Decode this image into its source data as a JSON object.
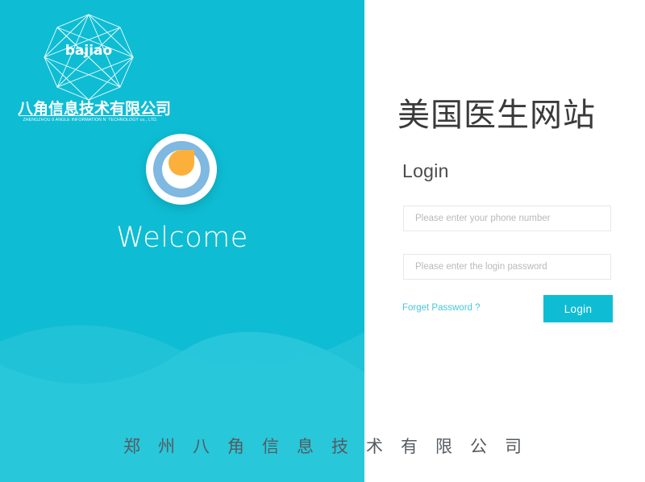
{
  "brand": {
    "logo_mark_text": "bajiao",
    "company_name_cn": "八角信息技术有限公司",
    "company_name_en": "ZHENGZHOU 8 ANGLE INFORMATION N' TECHNOLOGY co., LTD.",
    "welcome_text": "Welcome",
    "panel_color": "#0ebdd4",
    "emblem_ring_color": "#7fb8e0",
    "emblem_center_color": "#fbb03b"
  },
  "login": {
    "site_title": "美国医生网站",
    "heading": "Login",
    "phone_placeholder": "Please enter your phone number",
    "phone_value": "",
    "password_placeholder": "Please enter the login password",
    "password_value": "",
    "forget_password_label": "Forget Password ?",
    "submit_label": "Login",
    "accent_color": "#0ebdd4",
    "link_color": "#49c6da"
  },
  "footer": {
    "text": "郑州八角信息技术有限公司"
  }
}
